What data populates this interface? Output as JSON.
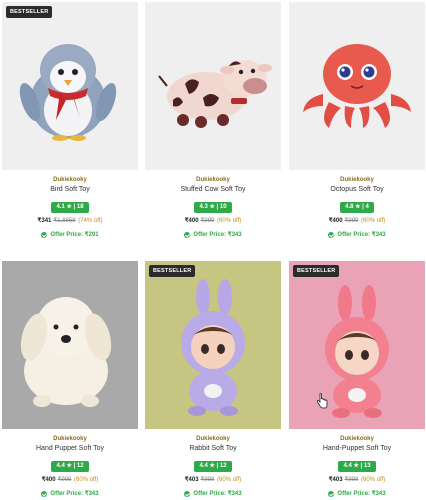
{
  "products": [
    {
      "badge": "BESTSELLER",
      "brand": "Dukiekooky",
      "title": "Bird Soft Toy",
      "rating": "4.1 ★ | 18",
      "price": "₹341",
      "mrp": "₹1,8858",
      "discount": "(74% off)",
      "offer": "Offer Price: ₹291",
      "bg": "#efefef",
      "image": "penguin-toy"
    },
    {
      "badge": "",
      "brand": "Dukiekooky",
      "title": "Stuffed Cow Soft Toy",
      "rating": "4.3 ★ | 10",
      "price": "₹400",
      "mrp": "₹999",
      "discount": "(60% off)",
      "offer": "Offer Price: ₹343",
      "bg": "#efefef",
      "image": "cow-toy"
    },
    {
      "badge": "",
      "brand": "Dukiekooky",
      "title": "Octopus Soft Toy",
      "rating": "4.8 ★ | 4",
      "price": "₹400",
      "mrp": "₹999",
      "discount": "(60% off)",
      "offer": "Offer Price: ₹343",
      "bg": "#efefef",
      "image": "octopus-toy"
    },
    {
      "badge": "",
      "brand": "Dukiekooky",
      "title": "Hand Puppet Soft Toy",
      "rating": "4.4 ★ | 12",
      "price": "₹400",
      "mrp": "₹999",
      "discount": "(60% off)",
      "offer": "Offer Price: ₹343",
      "bg": "#a9a9a9",
      "image": "puppy-toy"
    },
    {
      "badge": "BESTSELLER",
      "brand": "Dukiekooky",
      "title": "Rabbit Soft Toy",
      "rating": "4.4 ★ | 12",
      "price": "₹403",
      "mrp": "₹999",
      "discount": "(60% off)",
      "offer": "Offer Price: ₹343",
      "bg": "#c6c582",
      "image": "rabbit-purple-toy"
    },
    {
      "badge": "BESTSELLER",
      "brand": "Dukiekooky",
      "title": "Hand-Puppet Soft Toy",
      "rating": "4.4 ★ | 13",
      "price": "₹403",
      "mrp": "₹999",
      "discount": "(60% off)",
      "offer": "Offer Price: ₹343",
      "bg": "#eaa3b6",
      "image": "rabbit-pink-toy"
    }
  ],
  "colors": {
    "rating_green": "#2eaa4a",
    "brand_gold": "#8a6d1e",
    "badge_dark": "#2b2b2b"
  }
}
